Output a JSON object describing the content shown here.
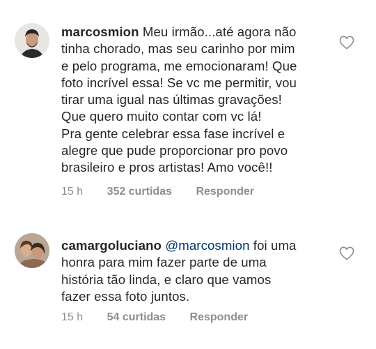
{
  "comments": [
    {
      "username": "marcosmion",
      "mention": "",
      "text": "Meu irmão...até agora não\ntinha chorado, mas seu carinho por mim\ne pelo programa, me emocionaram! Que\nfoto incrível essa! Se vc me permitir, vou\ntirar uma igual nas últimas gravações!\nQue quero muito contar com vc lá!\nPra gente celebrar essa fase incrível e\nalegre que pude proporcionar pro povo\nbrasileiro e pros artistas! Amo você!!",
      "time": "15 h",
      "likes": "352 curtidas",
      "reply": "Responder"
    },
    {
      "username": "camargoluciano",
      "mention": "@marcosmion",
      "text": "foi uma\nhonra para mim fazer parte de uma\nhistória tão linda, e claro que vamos\nfazer essa foto juntos.",
      "time": "15 h",
      "likes": "54 curtidas",
      "reply": "Responder"
    }
  ],
  "icons": {
    "avatar1": "avatar-marcosmion",
    "avatar2": "avatar-camargoluciano",
    "like": "heart-outline-icon"
  }
}
